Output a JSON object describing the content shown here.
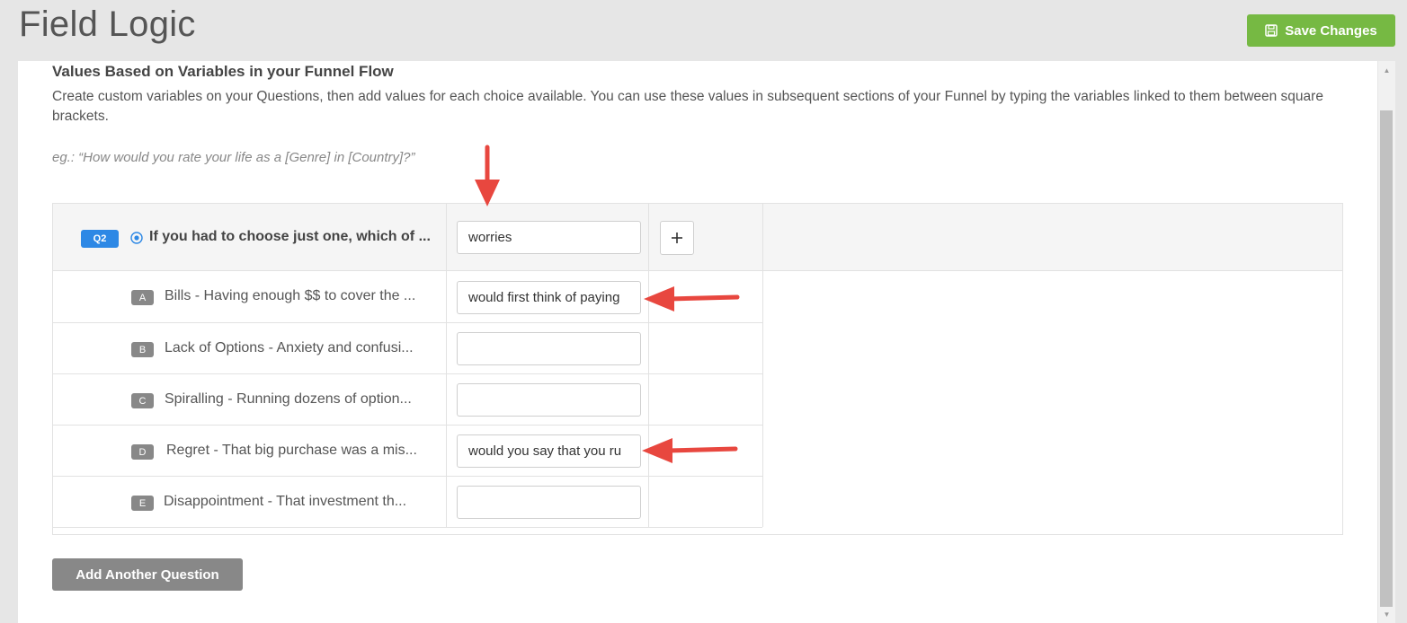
{
  "page": {
    "title": "Field Logic",
    "save_label": "Save Changes"
  },
  "section": {
    "heading": "Values Based on Variables in your Funnel Flow",
    "description": "Create custom variables on your Questions, then add values for each choice available. You can use these values in subsequent sections of your Funnel by typing the variables linked to them between square brackets.",
    "example": "eg.: “How would you rate your life as a [Genre] in [Country]?”"
  },
  "question": {
    "badge": "Q2",
    "text": "If you had to choose just one, which of ...",
    "variable_value": "worries"
  },
  "choices": [
    {
      "letter": "A",
      "text": "Bills - Having enough $$ to cover the ...",
      "value": "would first think of paying"
    },
    {
      "letter": "B",
      "text": "Lack of Options - Anxiety and confusi...",
      "value": ""
    },
    {
      "letter": "C",
      "text": "Spiralling - Running dozens of option...",
      "value": ""
    },
    {
      "letter": "D",
      "text": "Regret - That big purchase was a mis...",
      "value": "would you say that you ru"
    },
    {
      "letter": "E",
      "text": "Disappointment - That investment th...",
      "value": ""
    }
  ],
  "add_question_label": "Add Another Question",
  "colors": {
    "save_button": "#76b943",
    "question_badge": "#2d88e5",
    "annotation_arrow": "#e8473f"
  },
  "icons": {
    "save": "floppy-disk-icon",
    "radio": "radio-button-icon",
    "add": "plus-icon"
  }
}
